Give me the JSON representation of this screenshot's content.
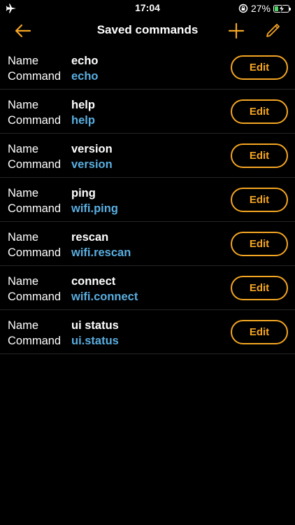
{
  "status_bar": {
    "time": "17:04",
    "battery_percent": "27%",
    "battery_level": 0.27,
    "left_icon": "airplane-icon",
    "rotation_lock_icon": "rotation-lock-icon"
  },
  "nav": {
    "title": "Saved commands",
    "back_icon": "arrow-left-icon",
    "add_icon": "plus-icon",
    "edit_icon": "pencil-icon"
  },
  "labels": {
    "name": "Name",
    "command": "Command",
    "edit": "Edit"
  },
  "commands": [
    {
      "name": "echo",
      "command": "echo"
    },
    {
      "name": "help",
      "command": "help"
    },
    {
      "name": "version",
      "command": "version"
    },
    {
      "name": "ping",
      "command": "wifi.ping"
    },
    {
      "name": "rescan",
      "command": "wifi.rescan"
    },
    {
      "name": "connect",
      "command": "wifi.connect"
    },
    {
      "name": "ui status",
      "command": "ui.status"
    }
  ],
  "colors": {
    "accent": "#f5a623",
    "command_text": "#5aaee0",
    "background": "#000000",
    "battery_fill": "#4cd964"
  }
}
